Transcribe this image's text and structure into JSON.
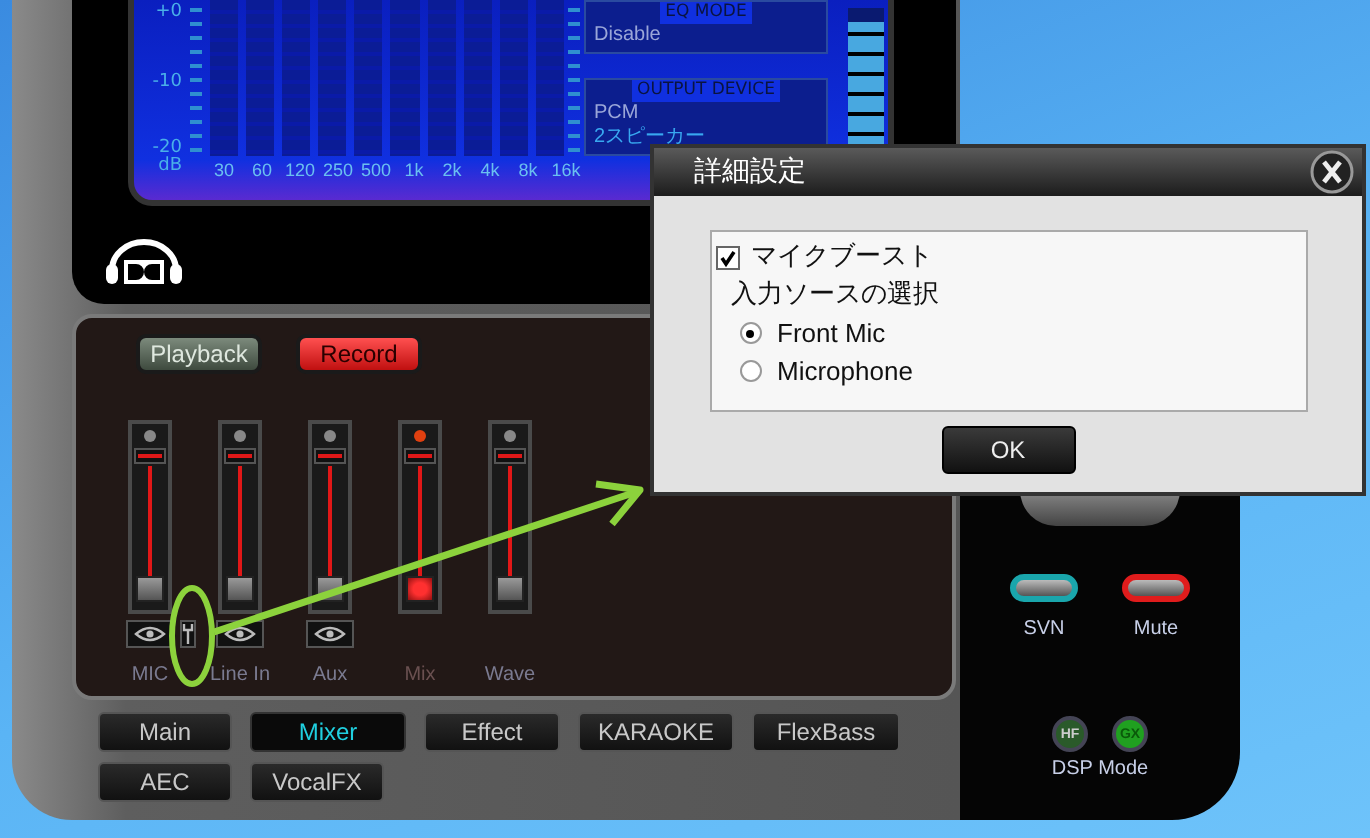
{
  "eq_display": {
    "db_labels": [
      "+0",
      "-10",
      "-20"
    ],
    "unit": "dB",
    "bands": [
      "30",
      "60",
      "120",
      "250",
      "500",
      "1k",
      "2k",
      "4k",
      "8k",
      "16k"
    ]
  },
  "eq_mode": {
    "label": "EQ MODE",
    "value": "Disable"
  },
  "output_device": {
    "label": "OUTPUT DEVICE",
    "format": "PCM",
    "speakers": "2スピーカー"
  },
  "output_meter": {
    "level": 0.92
  },
  "mixer": {
    "modes": [
      {
        "label": "Playback",
        "selected": false
      },
      {
        "label": "Record",
        "selected": true
      }
    ],
    "channels": [
      {
        "label": "MIC",
        "level": 1,
        "selected": false,
        "monitor": true,
        "settings": true
      },
      {
        "label": "Line In",
        "level": 1,
        "selected": false,
        "monitor": true,
        "settings": false
      },
      {
        "label": "Aux",
        "level": 1,
        "selected": false,
        "monitor": true,
        "settings": false
      },
      {
        "label": "Mix",
        "level": 1,
        "selected": true,
        "monitor": false,
        "settings": false
      },
      {
        "label": "Wave",
        "level": 1,
        "selected": false,
        "monitor": false,
        "settings": false
      }
    ]
  },
  "nav_tabs": [
    {
      "label": "Main",
      "selected": false
    },
    {
      "label": "Mixer",
      "selected": true
    },
    {
      "label": "Effect",
      "selected": false
    },
    {
      "label": "KARAOKE",
      "selected": false
    },
    {
      "label": "FlexBass",
      "selected": false
    },
    {
      "label": "AEC",
      "selected": false
    },
    {
      "label": "VocalFX",
      "selected": false
    }
  ],
  "side_panel": {
    "buttons": [
      {
        "label": "SVN",
        "color": "#1aa6ac"
      },
      {
        "label": "Mute",
        "color": "#e01c1c"
      }
    ],
    "dsp_modes": [
      {
        "label": "HF",
        "on": false
      },
      {
        "label": "GX",
        "on": true
      }
    ],
    "dsp_label": "DSP Mode"
  },
  "dialog": {
    "title": "詳細設定",
    "boost": {
      "label": "マイクブースト",
      "checked": true
    },
    "source_label": "入力ソースの選択",
    "sources": [
      {
        "label": "Front Mic",
        "selected": true
      },
      {
        "label": "Microphone",
        "selected": false
      }
    ],
    "ok": "OK"
  }
}
